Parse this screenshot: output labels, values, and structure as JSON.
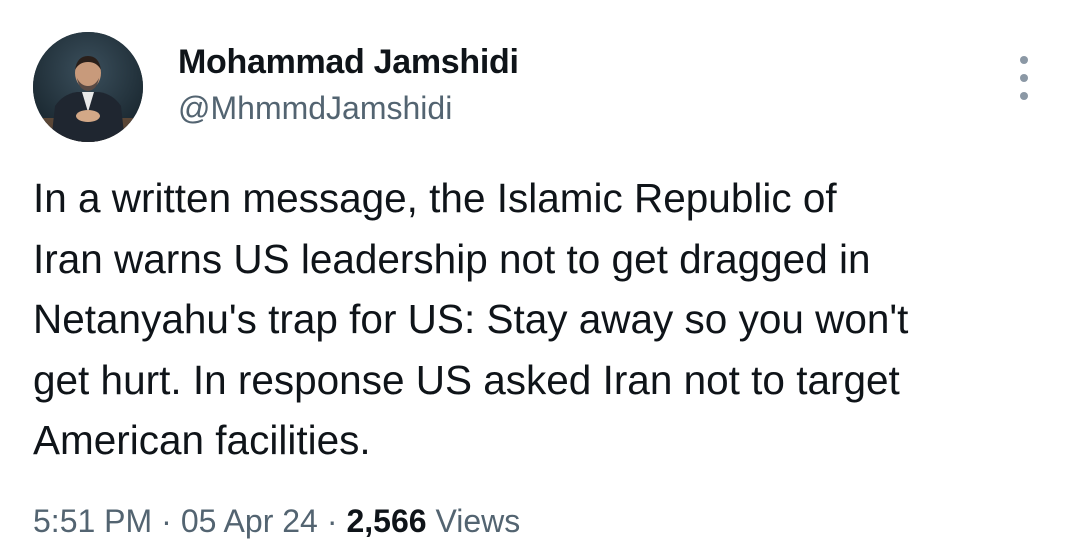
{
  "author": {
    "name": "Mohammad Jamshidi",
    "handle": "@MhmmdJamshidi"
  },
  "tweet": {
    "lines": [
      "In a written message, the Islamic Republic of",
      "Iran warns US leadership not to get dragged in",
      "Netanyahu's trap for US: Stay away so you won't",
      "get hurt. In response US asked Iran not to target",
      "American facilities."
    ]
  },
  "meta": {
    "time": "5:51 PM",
    "separator": "·",
    "date": "05 Apr 24",
    "views_count": "2,566",
    "views_label": "Views"
  },
  "icons": {
    "more": "more-vertical-icon",
    "avatar": "profile-photo"
  },
  "colors": {
    "text_primary": "#0f1419",
    "text_secondary": "#536471",
    "icon_gray": "#8b98a5",
    "background": "#ffffff"
  }
}
